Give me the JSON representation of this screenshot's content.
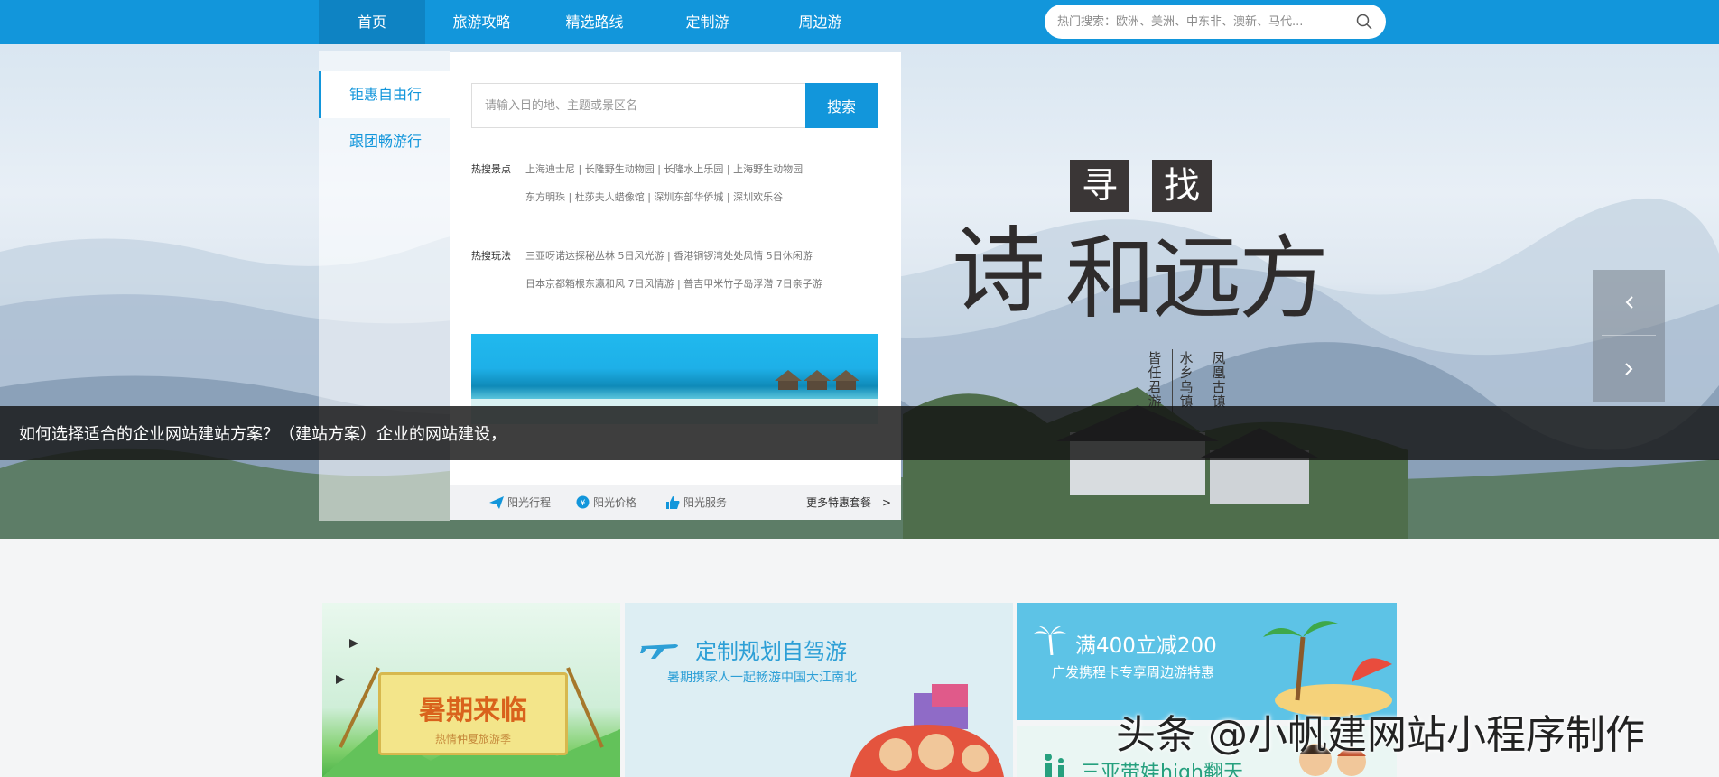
{
  "nav": {
    "items": [
      {
        "label": "首页"
      },
      {
        "label": "旅游攻略"
      },
      {
        "label": "精选路线"
      },
      {
        "label": "定制游"
      },
      {
        "label": "周边游"
      }
    ],
    "search_placeholder": "热门搜索：欧洲、美洲、中东非、澳新、马代..."
  },
  "hero": {
    "tabs": [
      {
        "label": "钜惠自由行"
      },
      {
        "label": "跟团畅游行"
      }
    ],
    "search": {
      "placeholder": "请输入目的地、主题或景区名",
      "button_label": "搜索"
    },
    "hot_spots": {
      "label": "热搜景点",
      "line1": "上海迪士尼 | 长隆野生动物园 | 长隆水上乐园 | 上海野生动物园",
      "line2": "东方明珠 | 杜莎夫人蜡像馆 | 深圳东部华侨城 | 深圳欢乐谷"
    },
    "hot_play": {
      "label": "热搜玩法",
      "line1": "三亚呀诺达探秘丛林 5日风光游 | 香港铜锣湾处处风情 5日休闲游",
      "line2": "日本京都箱根东瀛和风 7日风情游 | 普吉甲米竹子岛浮潜 7日亲子游"
    },
    "footer": {
      "item1": "阳光行程",
      "item2": "阳光价格",
      "item3": "阳光服务",
      "more": "更多特惠套餐",
      "more_arrow": ">"
    },
    "caption": "如何选择适合的企业网站建站方案？（建站方案）企业的网站建设，",
    "poem": {
      "tag1": "寻",
      "tag2": "找",
      "big1": "诗",
      "big2": "和远方",
      "vert1": "凤凰古镇",
      "vert2": "水乡乌镇",
      "vert3": "皆任君游"
    }
  },
  "promos": {
    "card1": {
      "title": "暑期来临",
      "sub": "热情仲夏旅游季"
    },
    "card2": {
      "title": "定制规划自驾游",
      "sub": "暑期携家人一起畅游中国大江南北"
    },
    "card3": {
      "title": "满400立减200",
      "sub": "广发携程卡专享周边游特惠"
    },
    "card4": {
      "title": "三亚带娃high翻天"
    }
  },
  "watermark": "头条 @小帆建网站小程序制作",
  "colors": {
    "primary": "#1296db",
    "nav_active": "#0e83c3",
    "caption_bg": "#141414"
  }
}
